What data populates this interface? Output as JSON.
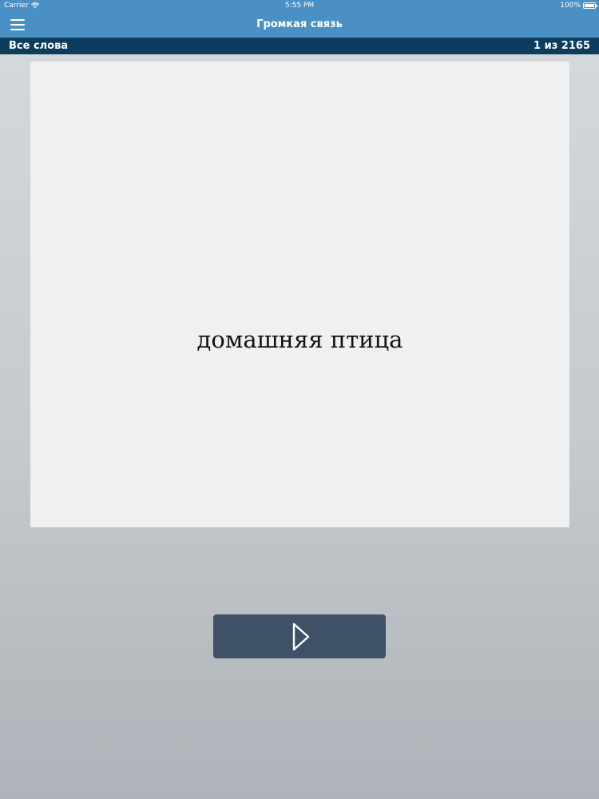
{
  "status_bar": {
    "carrier": "Carrier",
    "time": "5:55 PM",
    "battery": "100%",
    "wifi_icon": "wifi-icon",
    "battery_icon": "battery-icon"
  },
  "nav_bar": {
    "title": "Громкая связь",
    "menu_icon": "hamburger-menu-icon",
    "color": "#4b90c4"
  },
  "sub_bar": {
    "list_name": "Все слова",
    "counter": "1 из 2165",
    "color": "#0d3c5e"
  },
  "card": {
    "word": "домашняя птица",
    "background": "#eef0f2"
  },
  "next_button": {
    "icon": "play-icon",
    "background": "#3e5166"
  }
}
